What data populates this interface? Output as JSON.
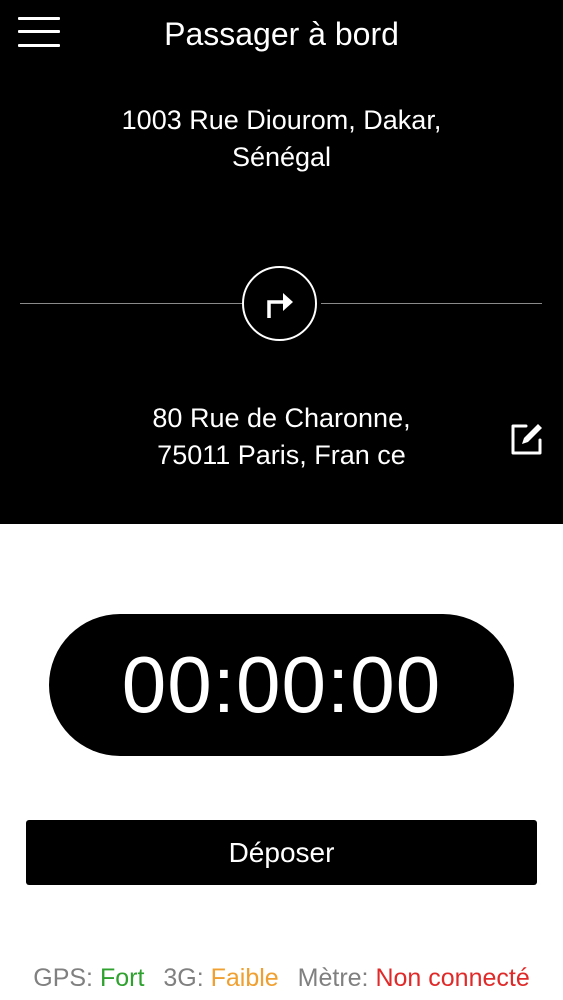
{
  "header": {
    "title": "Passager à bord",
    "menu_icon": "hamburger-menu-icon"
  },
  "trip": {
    "origin_line1": "1003 Rue Diourom, Dakar,",
    "origin_line2": "Sénégal",
    "turn_icon": "turn-right-arrow-icon",
    "destination_line1": "80 Rue de Charonne,",
    "destination_line2": "75011 Paris, Fran ce",
    "edit_icon": "edit-icon"
  },
  "timer": {
    "value": "00:00:00"
  },
  "actions": {
    "drop_label": "Déposer"
  },
  "status": {
    "gps_label": "GPS:",
    "gps_value": "Fort",
    "network_label": "3G:",
    "network_value": "Faible",
    "meter_label": "Mètre:",
    "meter_value": "Non connecté"
  },
  "colors": {
    "header_bg": "#000000",
    "gps_ok": "#2ea12e",
    "network_weak": "#f0a030",
    "meter_off": "#e02a2a",
    "status_label": "#808080"
  }
}
